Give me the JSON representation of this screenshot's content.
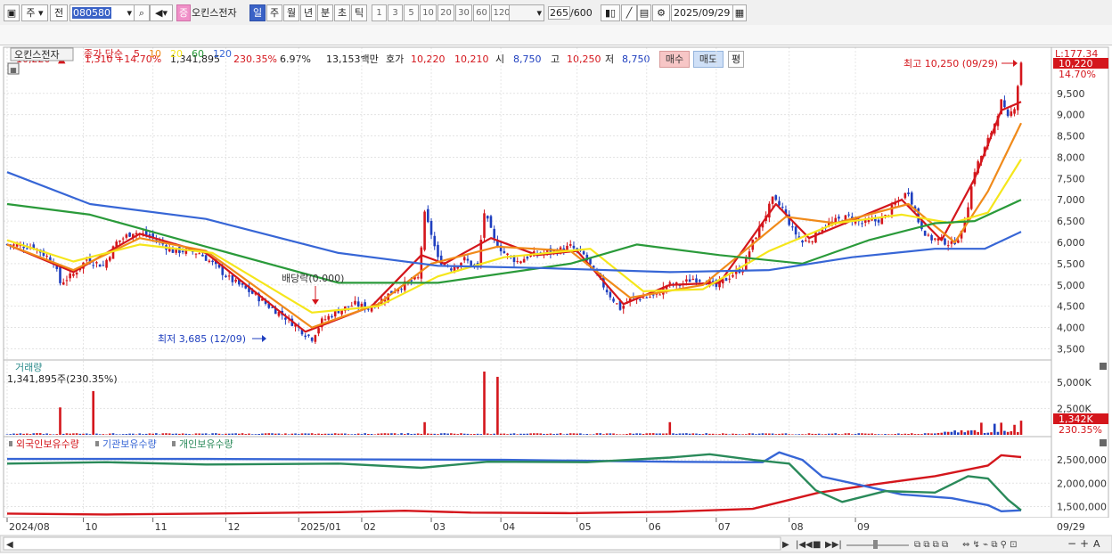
{
  "toolbar": {
    "market": "주",
    "prev_label": "전",
    "code": "080580",
    "name_badge": "증",
    "name": "오킨스전자",
    "periods": [
      "일",
      "주",
      "월",
      "년",
      "분",
      "초",
      "틱"
    ],
    "active_period": "일",
    "intervals": [
      "1",
      "3",
      "5",
      "10",
      "20",
      "30",
      "60",
      "120"
    ],
    "count": "265",
    "max_count": "600",
    "date": "2025/09/29"
  },
  "quote": {
    "price": "10,220",
    "change": "1,310",
    "change_pct": "+14.70%",
    "volume": "1,341,895",
    "vol_ratio": "230.35%",
    "turnover_rate": "6.97%",
    "amount": "13,153백만",
    "hoga_label": "호가",
    "ask": "10,220",
    "bid": "10,210",
    "open_label": "시",
    "open": "8,750",
    "high_label": "고",
    "high": "10,250",
    "low_label": "저",
    "low": "8,750",
    "buy": "매수",
    "sell": "매도",
    "avg": "평"
  },
  "price_panel": {
    "legend_name": "오킨스전자",
    "legend_ma": "종가 단순",
    "ma_periods": [
      "5",
      "10",
      "20",
      "60",
      "120"
    ],
    "ma_colors": [
      "#d4161c",
      "#f08a1a",
      "#f5e61b",
      "#2a9a3a",
      "#3766d6"
    ],
    "top_right": "L:177.34",
    "current_tag": "10,220",
    "pct_tag": "14.70%",
    "high_annot": "최고 10,250 (09/29)",
    "low_annot": "최저 3,685 (12/09)",
    "ex_div_annot": "배당락(0.000)"
  },
  "volume_panel": {
    "title": "거래량",
    "value": "1,341,895주(230.35%)",
    "tag": "1,342K",
    "tag_pct": "230.35%"
  },
  "holding_panel": {
    "legend": [
      "외국인보유수량",
      "기관보유수량",
      "개인보유수량"
    ],
    "legend_colors": [
      "#d4161c",
      "#3766d6",
      "#2a8a5a"
    ]
  },
  "x_axis": {
    "labels": [
      "2024/08",
      "10",
      "11",
      "12",
      "2025/01",
      "02",
      "03",
      "04",
      "05",
      "06",
      "07",
      "08",
      "09"
    ],
    "end_label": "09/29"
  },
  "chart_data": [
    {
      "type": "candlestick",
      "title": "오킨스전자",
      "ylim": [
        3300,
        10500
      ],
      "yticks": [
        3500,
        4000,
        4500,
        5000,
        5500,
        6000,
        6500,
        7000,
        7500,
        8000,
        8500,
        9000,
        9500
      ],
      "ytick_labels": [
        "3,500",
        "4,000",
        "4,500",
        "5,000",
        "5,500",
        "6,000",
        "6,500",
        "7,000",
        "7,500",
        "8,000",
        "8,500",
        "9,000",
        "9,500"
      ],
      "close_path": [
        [
          0,
          5950
        ],
        [
          8,
          5900
        ],
        [
          14,
          5550
        ],
        [
          16,
          5050
        ],
        [
          20,
          5250
        ],
        [
          24,
          5600
        ],
        [
          29,
          5450
        ],
        [
          33,
          6000
        ],
        [
          38,
          6250
        ],
        [
          43,
          6150
        ],
        [
          46,
          6000
        ],
        [
          50,
          5800
        ],
        [
          54,
          5800
        ],
        [
          58,
          5750
        ],
        [
          62,
          5500
        ],
        [
          67,
          5150
        ],
        [
          71,
          4950
        ],
        [
          75,
          4750
        ],
        [
          79,
          4500
        ],
        [
          83,
          4300
        ],
        [
          87,
          4050
        ],
        [
          90,
          3850
        ],
        [
          92,
          3750
        ],
        [
          95,
          4150
        ],
        [
          100,
          4400
        ],
        [
          105,
          4550
        ],
        [
          109,
          4450
        ],
        [
          113,
          4650
        ],
        [
          117,
          4900
        ],
        [
          121,
          5050
        ],
        [
          124,
          5150
        ],
        [
          126,
          6650
        ],
        [
          128,
          6200
        ],
        [
          130,
          5600
        ],
        [
          134,
          5400
        ],
        [
          138,
          5600
        ],
        [
          142,
          5400
        ],
        [
          144,
          6700
        ],
        [
          147,
          6050
        ],
        [
          150,
          5750
        ],
        [
          154,
          5550
        ],
        [
          158,
          5700
        ],
        [
          162,
          5750
        ],
        [
          166,
          5800
        ],
        [
          170,
          5900
        ],
        [
          174,
          5700
        ],
        [
          178,
          5200
        ],
        [
          182,
          4750
        ],
        [
          185,
          4450
        ],
        [
          188,
          4650
        ],
        [
          192,
          4700
        ],
        [
          196,
          4750
        ],
        [
          199,
          5000
        ],
        [
          203,
          5000
        ],
        [
          207,
          5150
        ],
        [
          211,
          5100
        ],
        [
          214,
          4950
        ],
        [
          218,
          5200
        ],
        [
          222,
          5400
        ],
        [
          225,
          6000
        ],
        [
          228,
          6500
        ],
        [
          231,
          7000
        ],
        [
          234,
          6800
        ],
        [
          237,
          6300
        ],
        [
          240,
          6000
        ],
        [
          243,
          6100
        ],
        [
          246,
          6350
        ],
        [
          250,
          6500
        ],
        [
          254,
          6600
        ],
        [
          258,
          6450
        ],
        [
          262,
          6500
        ],
        [
          265,
          6600
        ],
        [
          268,
          6900
        ],
        [
          272,
          7200
        ],
        [
          275,
          6500
        ],
        [
          278,
          6100
        ],
        [
          282,
          6050
        ],
        [
          285,
          5950
        ],
        [
          288,
          6200
        ],
        [
          290,
          6900
        ],
        [
          292,
          7700
        ],
        [
          295,
          8200
        ],
        [
          298,
          8800
        ],
        [
          300,
          9300
        ],
        [
          302,
          8900
        ],
        [
          304,
          9200
        ],
        [
          306,
          10220
        ]
      ],
      "high_point": {
        "date": "2025/09/29",
        "value": 10250
      },
      "low_point": {
        "date": "2024/12/09",
        "value": 3685
      },
      "series": [
        {
          "name": "5",
          "values": [
            [
              0,
              5950
            ],
            [
              20,
              5300
            ],
            [
              40,
              6200
            ],
            [
              60,
              5750
            ],
            [
              90,
              3900
            ],
            [
              110,
              4500
            ],
            [
              125,
              5700
            ],
            [
              132,
              5500
            ],
            [
              146,
              6100
            ],
            [
              160,
              5700
            ],
            [
              172,
              5800
            ],
            [
              186,
              4550
            ],
            [
              200,
              5000
            ],
            [
              215,
              5050
            ],
            [
              232,
              6900
            ],
            [
              242,
              6100
            ],
            [
              256,
              6550
            ],
            [
              270,
              7000
            ],
            [
              282,
              6050
            ],
            [
              292,
              7500
            ],
            [
              300,
              9100
            ],
            [
              306,
              9300
            ]
          ]
        },
        {
          "name": "10",
          "values": [
            [
              0,
              5950
            ],
            [
              20,
              5350
            ],
            [
              40,
              6100
            ],
            [
              60,
              5800
            ],
            [
              92,
              4000
            ],
            [
              112,
              4550
            ],
            [
              128,
              5500
            ],
            [
              148,
              5900
            ],
            [
              170,
              5800
            ],
            [
              188,
              4700
            ],
            [
              210,
              5000
            ],
            [
              235,
              6600
            ],
            [
              250,
              6450
            ],
            [
              272,
              6900
            ],
            [
              286,
              6000
            ],
            [
              296,
              7200
            ],
            [
              306,
              8800
            ]
          ]
        },
        {
          "name": "20",
          "values": [
            [
              0,
              6050
            ],
            [
              20,
              5550
            ],
            [
              40,
              5950
            ],
            [
              62,
              5750
            ],
            [
              92,
              4350
            ],
            [
              112,
              4500
            ],
            [
              130,
              5200
            ],
            [
              150,
              5650
            ],
            [
              176,
              5850
            ],
            [
              192,
              4850
            ],
            [
              210,
              4900
            ],
            [
              230,
              5800
            ],
            [
              250,
              6450
            ],
            [
              270,
              6650
            ],
            [
              285,
              6450
            ],
            [
              296,
              6700
            ],
            [
              306,
              7950
            ]
          ]
        },
        {
          "name": "60",
          "values": [
            [
              0,
              6900
            ],
            [
              25,
              6650
            ],
            [
              60,
              5900
            ],
            [
              100,
              5050
            ],
            [
              130,
              5050
            ],
            [
              170,
              5500
            ],
            [
              190,
              5950
            ],
            [
              215,
              5700
            ],
            [
              240,
              5500
            ],
            [
              260,
              6050
            ],
            [
              280,
              6450
            ],
            [
              292,
              6500
            ],
            [
              306,
              7000
            ]
          ]
        },
        {
          "name": "120",
          "values": [
            [
              0,
              7650
            ],
            [
              25,
              6900
            ],
            [
              60,
              6550
            ],
            [
              100,
              5750
            ],
            [
              130,
              5450
            ],
            [
              160,
              5400
            ],
            [
              200,
              5300
            ],
            [
              230,
              5350
            ],
            [
              255,
              5650
            ],
            [
              280,
              5850
            ],
            [
              295,
              5850
            ],
            [
              306,
              6250
            ]
          ]
        }
      ]
    },
    {
      "type": "bar",
      "title": "거래량",
      "ylim": [
        0,
        6000000
      ],
      "yticks": [
        2500000,
        5000000
      ],
      "ytick_labels": [
        "2,500K",
        "5,000K"
      ],
      "spikes": [
        [
          16,
          2600000
        ],
        [
          26,
          4150000
        ],
        [
          126,
          1200000
        ],
        [
          144,
          6000000
        ],
        [
          148,
          5500000
        ],
        [
          200,
          1200000
        ],
        [
          294,
          1150000
        ],
        [
          298,
          1050000
        ],
        [
          300,
          1150000
        ],
        [
          304,
          950000
        ],
        [
          306,
          1342000
        ]
      ]
    },
    {
      "type": "line",
      "title": "외국인보유수량 기관보유수량 개인보유수량",
      "ylim": [
        1300000,
        2750000
      ],
      "yticks": [
        1500000,
        2000000,
        2500000
      ],
      "ytick_labels": [
        "1,500,000",
        "2,000,000",
        "2,500,000"
      ],
      "series": [
        {
          "name": "외국인보유수량",
          "values": [
            [
              0,
              1350000
            ],
            [
              30,
              1330000
            ],
            [
              60,
              1350000
            ],
            [
              100,
              1380000
            ],
            [
              120,
              1410000
            ],
            [
              140,
              1370000
            ],
            [
              170,
              1360000
            ],
            [
              200,
              1390000
            ],
            [
              225,
              1450000
            ],
            [
              245,
              1800000
            ],
            [
              262,
              1980000
            ],
            [
              280,
              2150000
            ],
            [
              296,
              2380000
            ],
            [
              300,
              2600000
            ],
            [
              306,
              2560000
            ]
          ]
        },
        {
          "name": "기관보유수량",
          "values": [
            [
              0,
              2520000
            ],
            [
              60,
              2520000
            ],
            [
              100,
              2510000
            ],
            [
              150,
              2500000
            ],
            [
              200,
              2460000
            ],
            [
              220,
              2450000
            ],
            [
              228,
              2450000
            ],
            [
              233,
              2660000
            ],
            [
              240,
              2500000
            ],
            [
              246,
              2140000
            ],
            [
              255,
              2000000
            ],
            [
              270,
              1760000
            ],
            [
              285,
              1680000
            ],
            [
              296,
              1530000
            ],
            [
              300,
              1400000
            ],
            [
              306,
              1420000
            ]
          ]
        },
        {
          "name": "개인보유수량",
          "values": [
            [
              0,
              2420000
            ],
            [
              30,
              2450000
            ],
            [
              60,
              2400000
            ],
            [
              100,
              2420000
            ],
            [
              125,
              2330000
            ],
            [
              145,
              2460000
            ],
            [
              175,
              2450000
            ],
            [
              200,
              2550000
            ],
            [
              212,
              2620000
            ],
            [
              225,
              2500000
            ],
            [
              236,
              2420000
            ],
            [
              244,
              1850000
            ],
            [
              252,
              1600000
            ],
            [
              265,
              1830000
            ],
            [
              280,
              1800000
            ],
            [
              290,
              2150000
            ],
            [
              296,
              2100000
            ],
            [
              302,
              1650000
            ],
            [
              306,
              1420000
            ]
          ]
        }
      ]
    }
  ]
}
